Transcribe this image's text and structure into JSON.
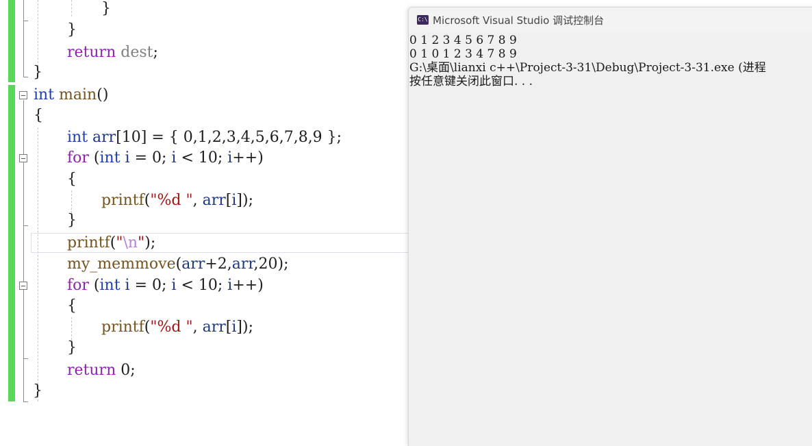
{
  "editor": {
    "lines": {
      "l01": {
        "t1": "}"
      },
      "l02": {
        "t1": "}"
      },
      "l03": {
        "t1": "return",
        "t2": " ",
        "t3": "dest",
        "t4": ";"
      },
      "l04": {
        "t1": "}"
      },
      "l05": {
        "t1": "int",
        "t2": " ",
        "t3": "main",
        "t4": "()"
      },
      "l06": {
        "t1": "{"
      },
      "l07": {
        "t1": "int",
        "t2": " ",
        "t3": "arr",
        "t4": "[10] = { 0,1,2,3,4,5,6,7,8,9 };"
      },
      "l08": {
        "t1": "for",
        "t2": " (",
        "t3": "int",
        "t4": " ",
        "t5": "i",
        "t6": " = 0; ",
        "t7": "i",
        "t8": " < 10; ",
        "t9": "i",
        "t10": "++)"
      },
      "l09": {
        "t1": "{"
      },
      "l10": {
        "t1": "printf",
        "t2": "(",
        "t3": "\"%d \"",
        "t4": ", ",
        "t5": "arr",
        "t6": "[",
        "t7": "i",
        "t8": "]);"
      },
      "l11": {
        "t1": "}"
      },
      "l12": {
        "t1": "printf",
        "t2": "(",
        "t3": "\"",
        "t4": "\\n",
        "t5": "\"",
        "t6": ");"
      },
      "l13": {
        "t1": "my_memmove",
        "t2": "(",
        "t3": "arr",
        "t4": "+2,",
        "t5": "arr",
        "t6": ",20);"
      },
      "l14": {
        "t1": "for",
        "t2": " (",
        "t3": "int",
        "t4": " ",
        "t5": "i",
        "t6": " = 0; ",
        "t7": "i",
        "t8": " < 10; ",
        "t9": "i",
        "t10": "++)"
      },
      "l15": {
        "t1": "{"
      },
      "l16": {
        "t1": "printf",
        "t2": "(",
        "t3": "\"%d \"",
        "t4": ", ",
        "t5": "arr",
        "t6": "[",
        "t7": "i",
        "t8": "]);"
      },
      "l17": {
        "t1": "}"
      },
      "l18": {
        "t1": "return",
        "t2": " 0;"
      },
      "l19": {
        "t1": "}"
      }
    }
  },
  "console": {
    "icon_label": "C:\\",
    "title": "Microsoft Visual Studio 调试控制台",
    "output": [
      "0 1 2 3 4 5 6 7 8 9",
      "0 1 0 1 2 3 4 7 8 9",
      "G:\\桌面\\lianxi c++\\Project-3-31\\Debug\\Project-3-31.exe (进程",
      "按任意键关闭此窗口. . ."
    ]
  },
  "colors": {
    "keyword": "#1f3fb0",
    "control": "#8a24a8",
    "function": "#74531f",
    "variable": "#1f377f",
    "string": "#a31515",
    "change_marker": "#5fd35f"
  }
}
